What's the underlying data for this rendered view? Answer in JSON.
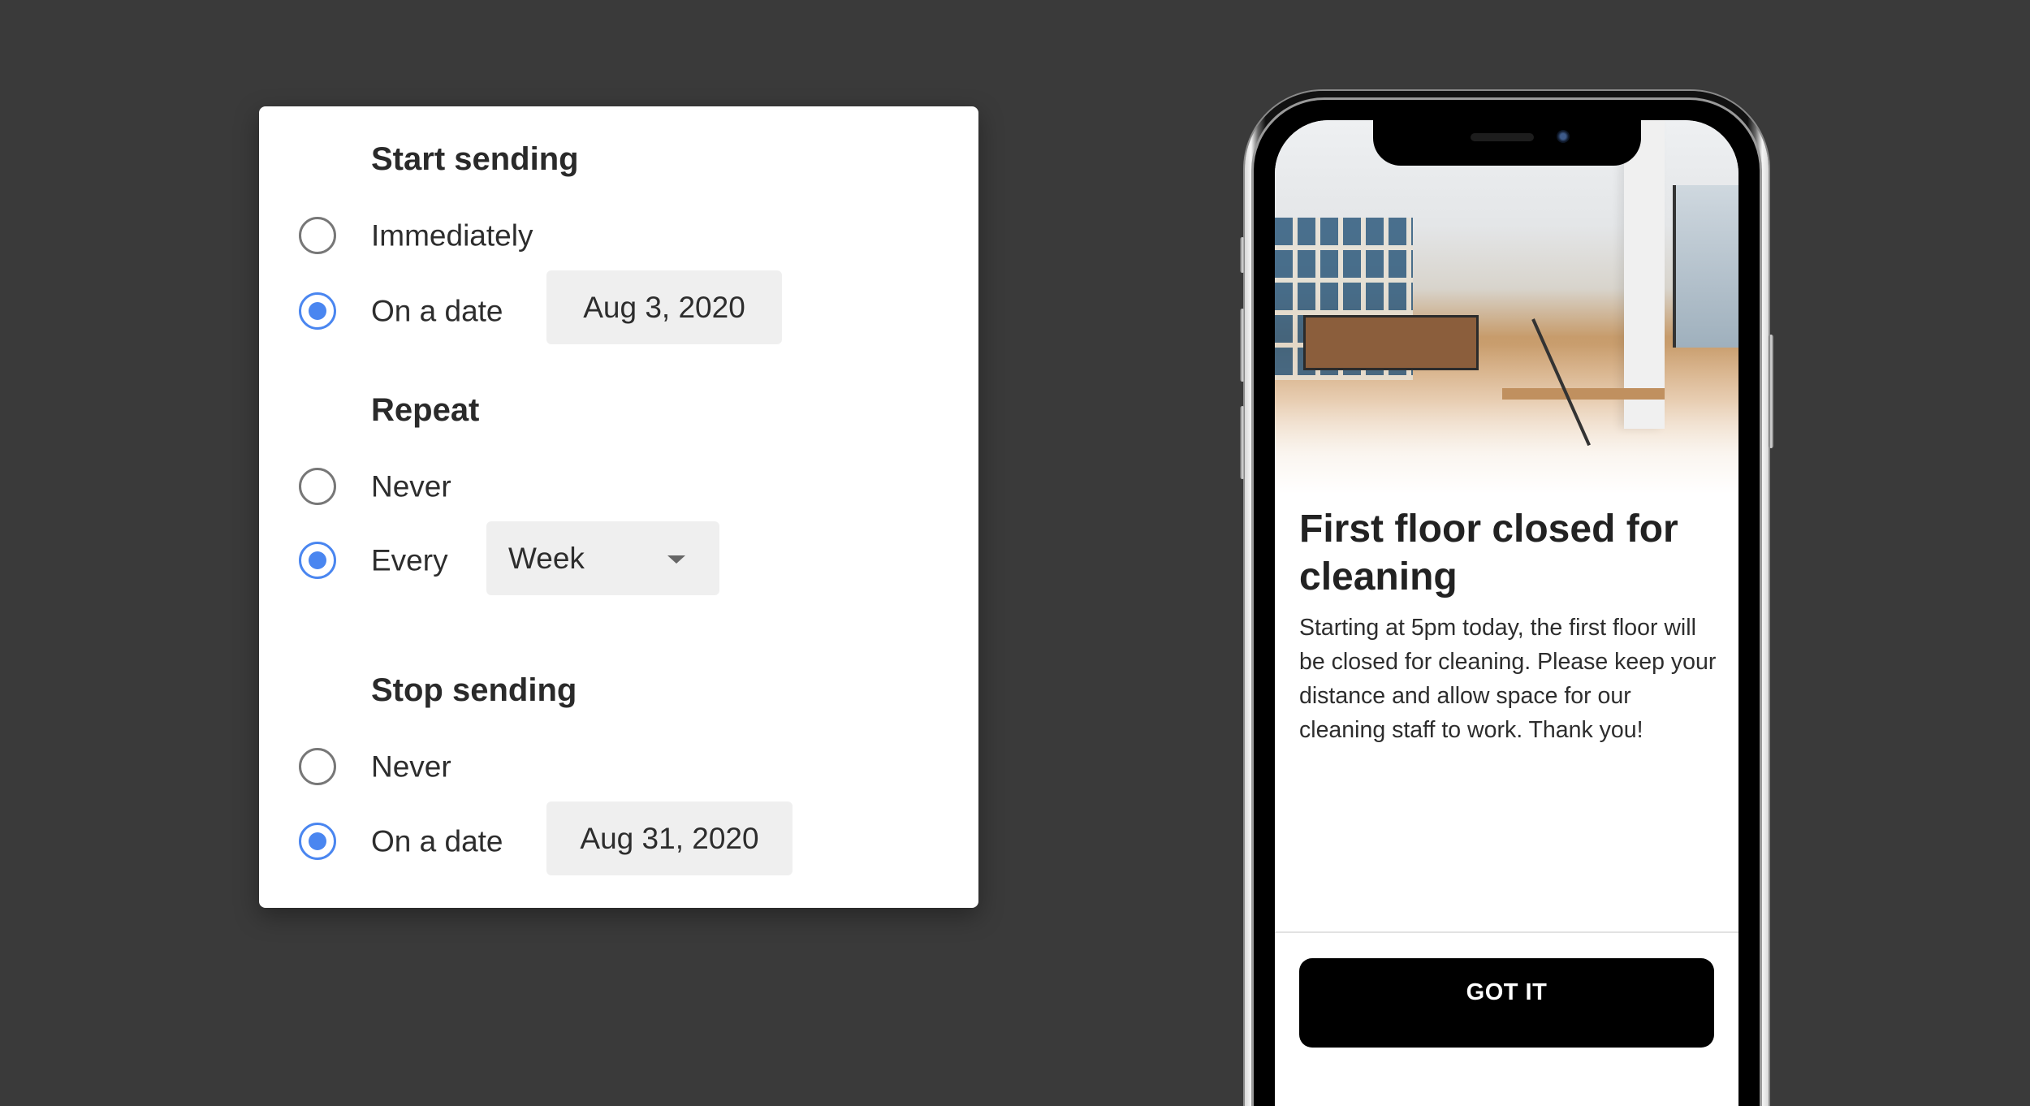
{
  "scheduler": {
    "start_sending": {
      "heading": "Start sending",
      "options": [
        {
          "label": "Immediately",
          "checked": false
        },
        {
          "label": "On a date",
          "checked": true,
          "value": "Aug 3, 2020"
        }
      ]
    },
    "repeat": {
      "heading": "Repeat",
      "options": [
        {
          "label": "Never",
          "checked": false
        },
        {
          "label": "Every",
          "checked": true,
          "value": "Week"
        }
      ]
    },
    "stop_sending": {
      "heading": "Stop sending",
      "options": [
        {
          "label": "Never",
          "checked": false
        },
        {
          "label": "On a date",
          "checked": true,
          "value": "Aug 31, 2020"
        }
      ]
    },
    "accent_color": "#4a86f0"
  },
  "phone_preview": {
    "title": "First floor closed for cleaning",
    "body": "Starting at 5pm today, the first floor will be closed for cleaning. Please keep your distance and allow space for our cleaning staff to work. Thank you!",
    "button_label": "GOT IT",
    "image": "office-lobby-photo"
  }
}
